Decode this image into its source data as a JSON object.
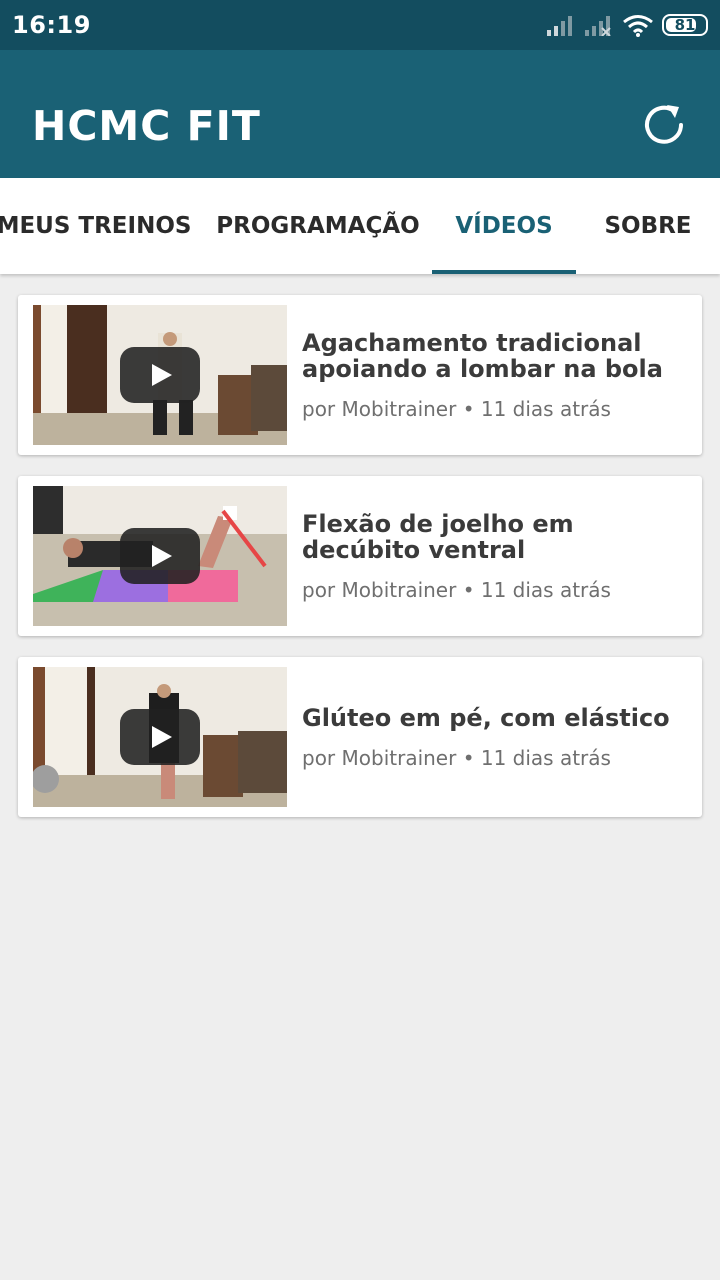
{
  "status_bar": {
    "time": "16:19",
    "battery": "81",
    "battery_level": 0.81,
    "icons": [
      "signal-icon",
      "signal-no-service-icon",
      "wifi-icon",
      "battery-icon"
    ]
  },
  "app_bar": {
    "title": "HCMC FIT",
    "refresh_icon": "refresh-icon",
    "color": "#1a6175"
  },
  "tabs": [
    {
      "label": "MEUS TREINOS",
      "active": false
    },
    {
      "label": "PROGRAMAÇÃO",
      "active": false
    },
    {
      "label": "VÍDEOS",
      "active": true
    },
    {
      "label": "SOBRE",
      "active": false
    }
  ],
  "videos": [
    {
      "title": "Agachamento tradicional apoiando a lombar na bola",
      "meta": "por Mobitrainer • 11 dias atrás"
    },
    {
      "title": "Flexão de joelho em decúbito ventral",
      "meta": "por Mobitrainer • 11 dias atrás"
    },
    {
      "title": "Glúteo em pé, com elástico",
      "meta": "por Mobitrainer • 11 dias atrás"
    }
  ]
}
